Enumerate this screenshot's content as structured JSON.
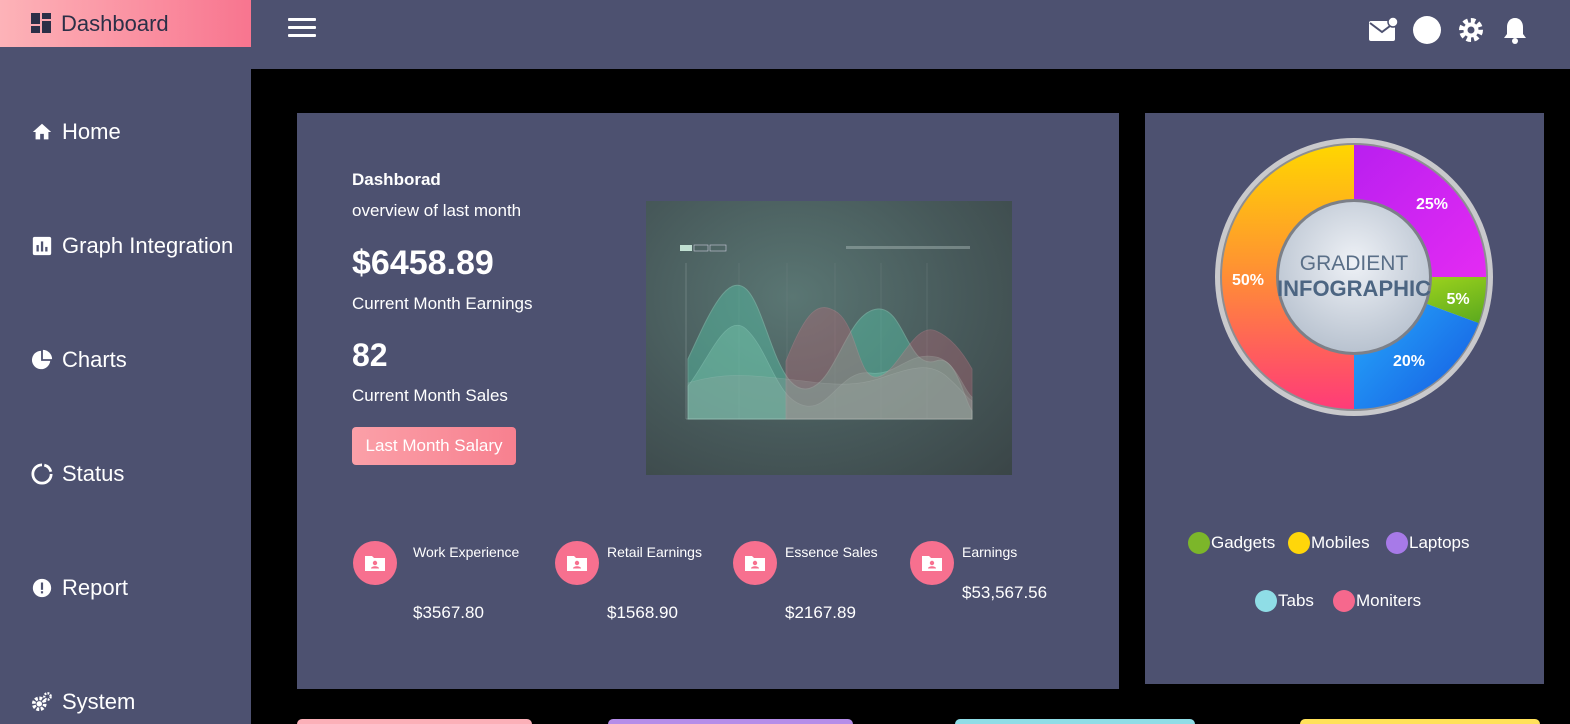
{
  "sidebar": {
    "brand_label": "Dashboard",
    "items": [
      {
        "label": "Home",
        "icon": "home-icon"
      },
      {
        "label": "Graph Integration",
        "icon": "bar-chart-icon"
      },
      {
        "label": "Charts",
        "icon": "pie-chart-icon"
      },
      {
        "label": "Status",
        "icon": "spinner-icon"
      },
      {
        "label": "Report",
        "icon": "alert-icon"
      },
      {
        "label": "System",
        "icon": "gears-icon"
      }
    ]
  },
  "topbar": {
    "icons": [
      "mail-notification-icon",
      "avatar-circle-icon",
      "gear-icon",
      "bell-icon"
    ]
  },
  "overview": {
    "title": "Dashborad",
    "subtitle": "overview of last month",
    "earnings_value": "$6458.89",
    "earnings_label": "Current Month Earnings",
    "sales_value": "82",
    "sales_label": "Current Month Sales",
    "salary_button": "Last Month Salary"
  },
  "stats": [
    {
      "label": "Work Experience",
      "value": "$3567.80",
      "icon": "user-folder-icon"
    },
    {
      "label": "Retail Earnings",
      "value": "$1568.90",
      "icon": "user-folder-icon"
    },
    {
      "label": "Essence Sales",
      "value": "$2167.89",
      "icon": "user-folder-icon"
    },
    {
      "label": "Earnings",
      "value": "$53,567.56",
      "icon": "user-folder-icon"
    }
  ],
  "infographic": {
    "title_line1": "GRADIENT",
    "title_line2": "INFOGRAPHIC",
    "segments": [
      {
        "label": "25%",
        "value": 25
      },
      {
        "label": "5%",
        "value": 5
      },
      {
        "label": "20%",
        "value": 20
      },
      {
        "label": "50%",
        "value": 50
      }
    ]
  },
  "legend": [
    {
      "label": "Gadgets",
      "color": "#7cb62a"
    },
    {
      "label": "Mobiles",
      "color": "#ffd60a"
    },
    {
      "label": "Laptops",
      "color": "#a77ae8"
    },
    {
      "label": "Tabs",
      "color": "#8fdde6"
    },
    {
      "label": "Moniters",
      "color": "#f6688d"
    }
  ],
  "colors": {
    "panel": "#4d5170",
    "background": "#000000",
    "accent_pink": "#f7708f",
    "brand_gradient_start": "#fdb3b8"
  }
}
